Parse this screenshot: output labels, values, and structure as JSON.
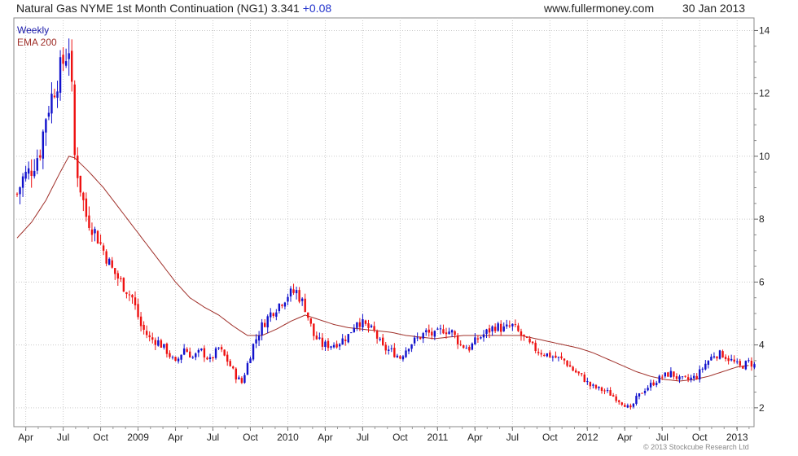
{
  "header": {
    "title": "Natural Gas NYME 1st Month Continuation (NG1) 3.341",
    "change": "+0.08",
    "site": "www.fullermoney.com",
    "date": "30 Jan 2013"
  },
  "footer": {
    "copyright": "© 2013 Stockcube Research Ltd"
  },
  "colors": {
    "up_candle": "#1111cc",
    "down_candle": "#ee1111",
    "ema": "#a0302a",
    "weekly_label": "#1a1aaa",
    "ema_label": "#a0302a",
    "grid": "#cccccc"
  },
  "chart_data": {
    "type": "candlestick",
    "legend": [
      "Weekly",
      "EMA 200"
    ],
    "legend_position": "top-left",
    "y_axis_side": "right",
    "ylim": [
      1.4,
      14.4
    ],
    "y_ticks": [
      2,
      4,
      6,
      8,
      10,
      12,
      14
    ],
    "x_ticks": [
      {
        "label": "Apr",
        "week": 3
      },
      {
        "label": "Jul",
        "week": 16
      },
      {
        "label": "Oct",
        "week": 29
      },
      {
        "label": "2009",
        "week": 42
      },
      {
        "label": "Apr",
        "week": 55
      },
      {
        "label": "Jul",
        "week": 68
      },
      {
        "label": "Oct",
        "week": 81
      },
      {
        "label": "2010",
        "week": 94
      },
      {
        "label": "Apr",
        "week": 107
      },
      {
        "label": "Jul",
        "week": 120
      },
      {
        "label": "Oct",
        "week": 133
      },
      {
        "label": "2011",
        "week": 146
      },
      {
        "label": "Apr",
        "week": 159
      },
      {
        "label": "Jul",
        "week": 172
      },
      {
        "label": "Oct",
        "week": 185
      },
      {
        "label": "2012",
        "week": 198
      },
      {
        "label": "Apr",
        "week": 211
      },
      {
        "label": "Jul",
        "week": 224
      },
      {
        "label": "Oct",
        "week": 237
      },
      {
        "label": "2013",
        "week": 250
      }
    ],
    "grid": true,
    "close_anchors": [
      [
        0,
        8.8
      ],
      [
        2,
        9.3
      ],
      [
        5,
        9.6
      ],
      [
        8,
        10.2
      ],
      [
        10,
        11.3
      ],
      [
        13,
        12.2
      ],
      [
        16,
        13.0
      ],
      [
        18,
        13.5
      ],
      [
        19,
        12.0
      ],
      [
        20,
        10.0
      ],
      [
        22,
        9.0
      ],
      [
        24,
        8.1
      ],
      [
        27,
        7.6
      ],
      [
        30,
        7.0
      ],
      [
        33,
        6.4
      ],
      [
        36,
        6.0
      ],
      [
        40,
        5.5
      ],
      [
        43,
        4.6
      ],
      [
        46,
        4.2
      ],
      [
        49,
        4.1
      ],
      [
        52,
        3.8
      ],
      [
        55,
        3.4
      ],
      [
        58,
        3.9
      ],
      [
        61,
        3.6
      ],
      [
        64,
        3.8
      ],
      [
        67,
        3.5
      ],
      [
        70,
        3.9
      ],
      [
        73,
        3.5
      ],
      [
        76,
        3.0
      ],
      [
        78,
        2.8
      ],
      [
        80,
        3.4
      ],
      [
        82,
        4.0
      ],
      [
        85,
        4.6
      ],
      [
        88,
        5.0
      ],
      [
        91,
        5.3
      ],
      [
        94,
        5.6
      ],
      [
        97,
        5.7
      ],
      [
        100,
        5.2
      ],
      [
        103,
        4.3
      ],
      [
        106,
        4.0
      ],
      [
        109,
        4.0
      ],
      [
        112,
        4.1
      ],
      [
        115,
        4.3
      ],
      [
        118,
        4.8
      ],
      [
        121,
        4.6
      ],
      [
        124,
        4.4
      ],
      [
        127,
        3.9
      ],
      [
        130,
        3.8
      ],
      [
        133,
        3.6
      ],
      [
        136,
        4.0
      ],
      [
        139,
        4.2
      ],
      [
        142,
        4.4
      ],
      [
        145,
        4.3
      ],
      [
        148,
        4.5
      ],
      [
        151,
        4.4
      ],
      [
        154,
        4.0
      ],
      [
        157,
        3.9
      ],
      [
        160,
        4.2
      ],
      [
        163,
        4.4
      ],
      [
        166,
        4.6
      ],
      [
        169,
        4.5
      ],
      [
        172,
        4.6
      ],
      [
        175,
        4.3
      ],
      [
        178,
        4.0
      ],
      [
        181,
        3.8
      ],
      [
        184,
        3.7
      ],
      [
        187,
        3.6
      ],
      [
        190,
        3.5
      ],
      [
        193,
        3.2
      ],
      [
        196,
        3.0
      ],
      [
        199,
        2.7
      ],
      [
        202,
        2.6
      ],
      [
        205,
        2.5
      ],
      [
        208,
        2.3
      ],
      [
        211,
        2.1
      ],
      [
        213,
        1.95
      ],
      [
        215,
        2.3
      ],
      [
        218,
        2.6
      ],
      [
        221,
        2.8
      ],
      [
        224,
        3.0
      ],
      [
        227,
        3.1
      ],
      [
        230,
        2.9
      ],
      [
        233,
        2.9
      ],
      [
        236,
        3.0
      ],
      [
        239,
        3.4
      ],
      [
        242,
        3.7
      ],
      [
        245,
        3.7
      ],
      [
        248,
        3.5
      ],
      [
        251,
        3.3
      ],
      [
        254,
        3.45
      ],
      [
        256,
        3.35
      ]
    ],
    "ema_anchors": [
      [
        0,
        7.4
      ],
      [
        5,
        7.9
      ],
      [
        10,
        8.6
      ],
      [
        15,
        9.5
      ],
      [
        18,
        10.0
      ],
      [
        20,
        9.95
      ],
      [
        25,
        9.5
      ],
      [
        30,
        9.0
      ],
      [
        35,
        8.4
      ],
      [
        40,
        7.8
      ],
      [
        45,
        7.2
      ],
      [
        50,
        6.6
      ],
      [
        55,
        6.0
      ],
      [
        60,
        5.5
      ],
      [
        65,
        5.2
      ],
      [
        70,
        4.95
      ],
      [
        75,
        4.6
      ],
      [
        80,
        4.3
      ],
      [
        85,
        4.3
      ],
      [
        90,
        4.5
      ],
      [
        95,
        4.75
      ],
      [
        100,
        4.95
      ],
      [
        105,
        4.8
      ],
      [
        110,
        4.65
      ],
      [
        115,
        4.55
      ],
      [
        120,
        4.5
      ],
      [
        125,
        4.45
      ],
      [
        130,
        4.4
      ],
      [
        135,
        4.3
      ],
      [
        140,
        4.25
      ],
      [
        145,
        4.2
      ],
      [
        150,
        4.25
      ],
      [
        155,
        4.3
      ],
      [
        160,
        4.3
      ],
      [
        165,
        4.3
      ],
      [
        170,
        4.3
      ],
      [
        175,
        4.3
      ],
      [
        180,
        4.2
      ],
      [
        185,
        4.1
      ],
      [
        190,
        4.0
      ],
      [
        195,
        3.9
      ],
      [
        200,
        3.75
      ],
      [
        205,
        3.55
      ],
      [
        210,
        3.35
      ],
      [
        215,
        3.15
      ],
      [
        220,
        3.0
      ],
      [
        225,
        2.9
      ],
      [
        230,
        2.85
      ],
      [
        235,
        2.9
      ],
      [
        240,
        3.0
      ],
      [
        245,
        3.15
      ],
      [
        250,
        3.3
      ],
      [
        254,
        3.35
      ]
    ]
  }
}
